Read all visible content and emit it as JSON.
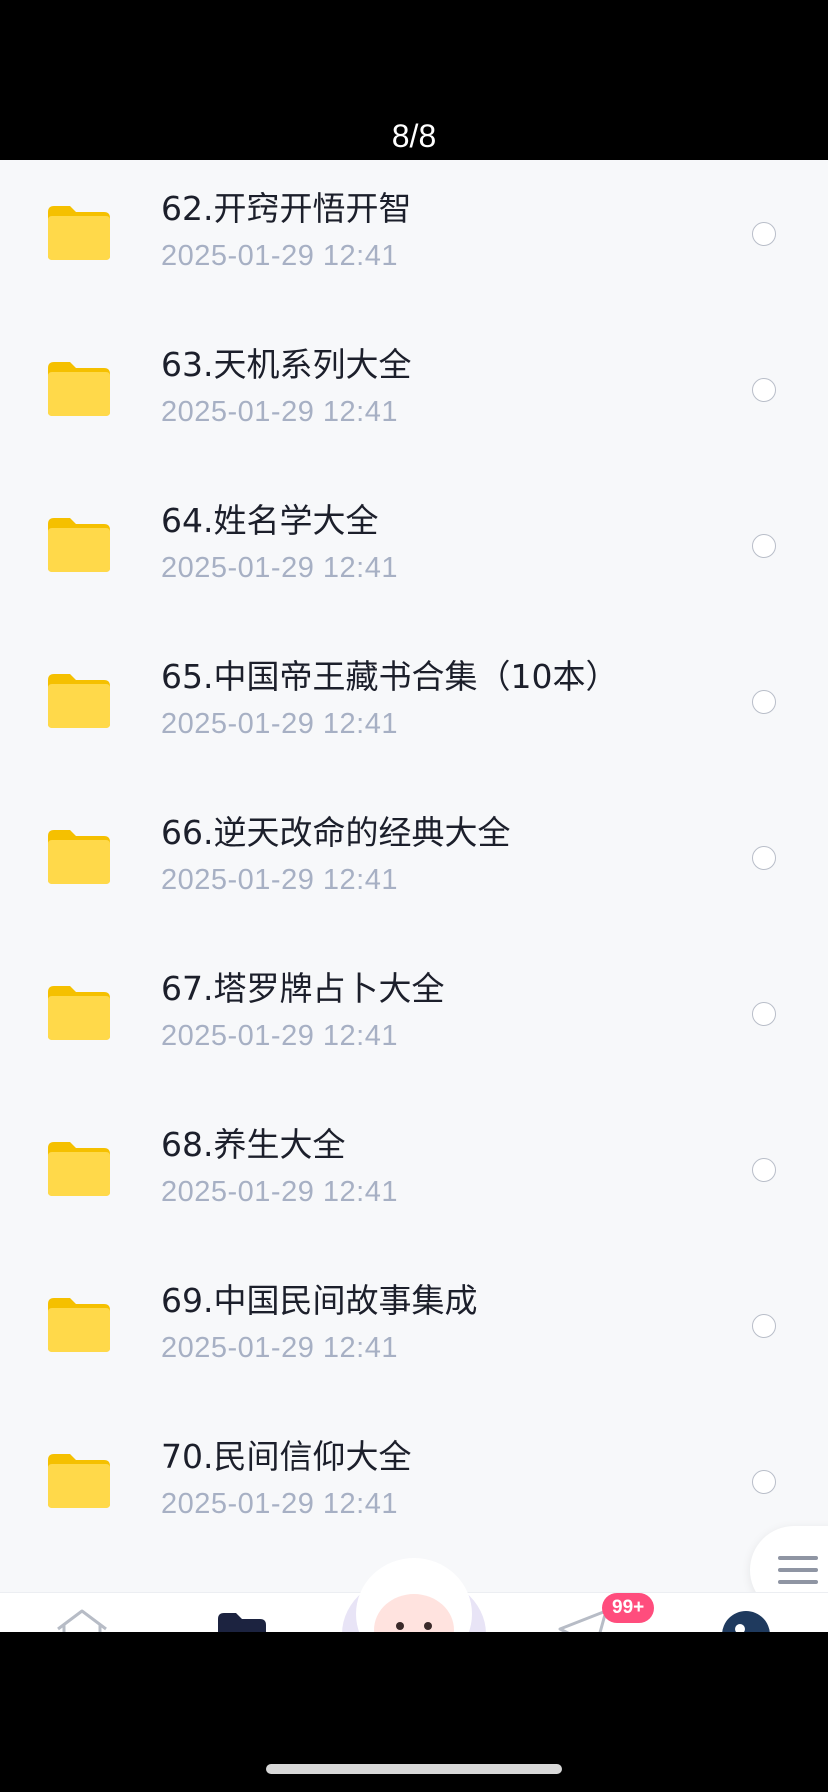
{
  "header": {
    "page_counter": "8/8"
  },
  "files": [
    {
      "title": "62.开窍开悟开智",
      "date": "2025-01-29  12:41"
    },
    {
      "title": "63.天机系列大全",
      "date": "2025-01-29  12:41"
    },
    {
      "title": "64.姓名学大全",
      "date": "2025-01-29  12:41"
    },
    {
      "title": "65.中国帝王藏书合集（10本）",
      "date": "2025-01-29  12:41"
    },
    {
      "title": "66.逆天改命的经典大全",
      "date": "2025-01-29  12:41"
    },
    {
      "title": "67.塔罗牌占卜大全",
      "date": "2025-01-29  12:41"
    },
    {
      "title": "68.养生大全",
      "date": "2025-01-29  12:41"
    },
    {
      "title": "69.中国民间故事集成",
      "date": "2025-01-29  12:41"
    },
    {
      "title": "70.民间信仰大全",
      "date": "2025-01-29  12:41"
    }
  ],
  "tabbar": {
    "items": [
      "home-icon",
      "files-icon",
      "mascot-avatar",
      "message-icon",
      "profile-avatar"
    ],
    "message_badge": "99+"
  },
  "colors": {
    "folder": "#ffd43b",
    "title": "#1c1f2b",
    "date": "#a7b0c4",
    "badge": "#ff4d7d"
  }
}
